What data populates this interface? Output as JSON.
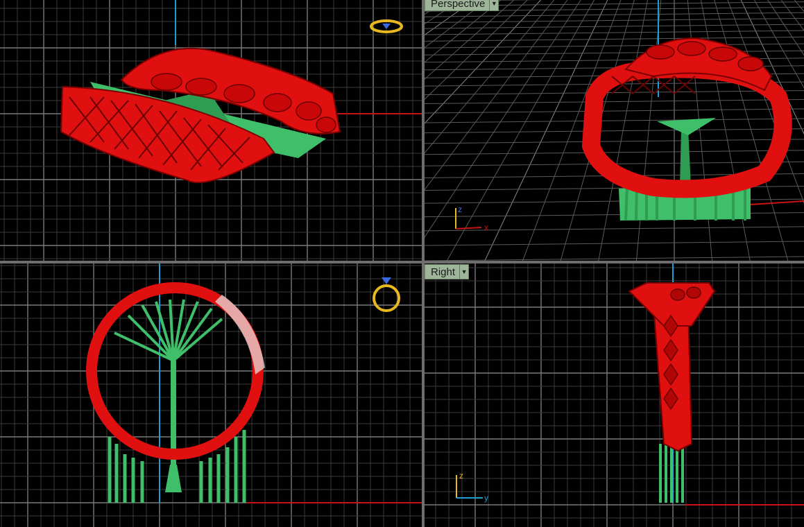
{
  "viewports": {
    "top_left": {
      "name": ""
    },
    "top_right": {
      "name": "Perspective",
      "axis_labels": {
        "z": "z",
        "x": "x"
      }
    },
    "bottom_left": {
      "name": ""
    },
    "bottom_right": {
      "name": "Right",
      "axis_labels": {
        "z": "z",
        "y": "y"
      }
    }
  },
  "icons": {
    "view_cube": "ring-navigation-icon",
    "dropdown": "chevron-down-icon"
  },
  "colors": {
    "background": "#000000",
    "grid_minor": "#3a3a3a",
    "grid_major": "#7a7a7a",
    "x_axis": "#c81414",
    "y_axis": "#1e9ecf",
    "model": "#e01010",
    "supports": "#3fbf6a",
    "viewport_tab": "#9fb59a"
  }
}
